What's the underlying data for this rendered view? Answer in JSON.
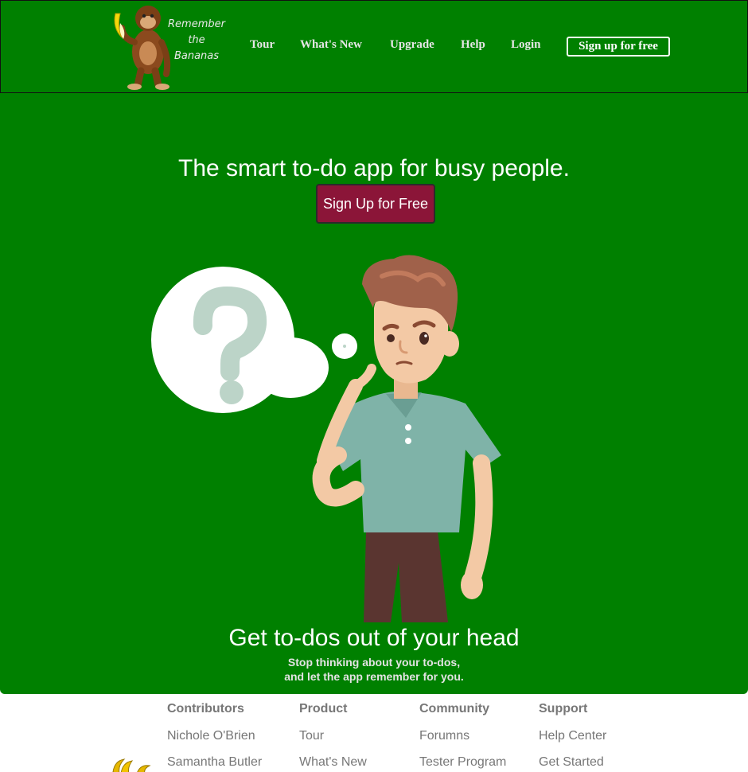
{
  "brand": {
    "logo_lines": [
      "Remember",
      "the",
      "Bananas"
    ],
    "logo_icon": "monkey-with-banana-icon"
  },
  "nav": {
    "items": [
      {
        "label": "Tour"
      },
      {
        "label": "What's New"
      },
      {
        "label": "Upgrade"
      },
      {
        "label": "Help"
      },
      {
        "label": "Login"
      }
    ],
    "signup_label": "Sign up for free"
  },
  "hero": {
    "title": "The smart to-do app for busy people.",
    "cta_label": "Sign Up for Free",
    "illustration_icon": "thinking-man-question-mark-icon",
    "section_title": "Get to-dos out of your head",
    "section_sub_lines": [
      "Stop thinking about your to-dos,",
      "and let the app remember for you."
    ]
  },
  "footer": {
    "columns": [
      {
        "heading": "Contributors",
        "links": [
          "Nichole O'Brien",
          "Samantha Butler"
        ]
      },
      {
        "heading": "Product",
        "links": [
          "Tour",
          "What's New"
        ]
      },
      {
        "heading": "Community",
        "links": [
          "Forumns",
          "Tester Program"
        ]
      },
      {
        "heading": "Support",
        "links": [
          "Help Center",
          "Get Started"
        ]
      }
    ],
    "icon": "bananas-icon"
  },
  "colors": {
    "brand_green": "#008000",
    "cta_maroon": "#8b1538",
    "footer_text": "#777777"
  }
}
